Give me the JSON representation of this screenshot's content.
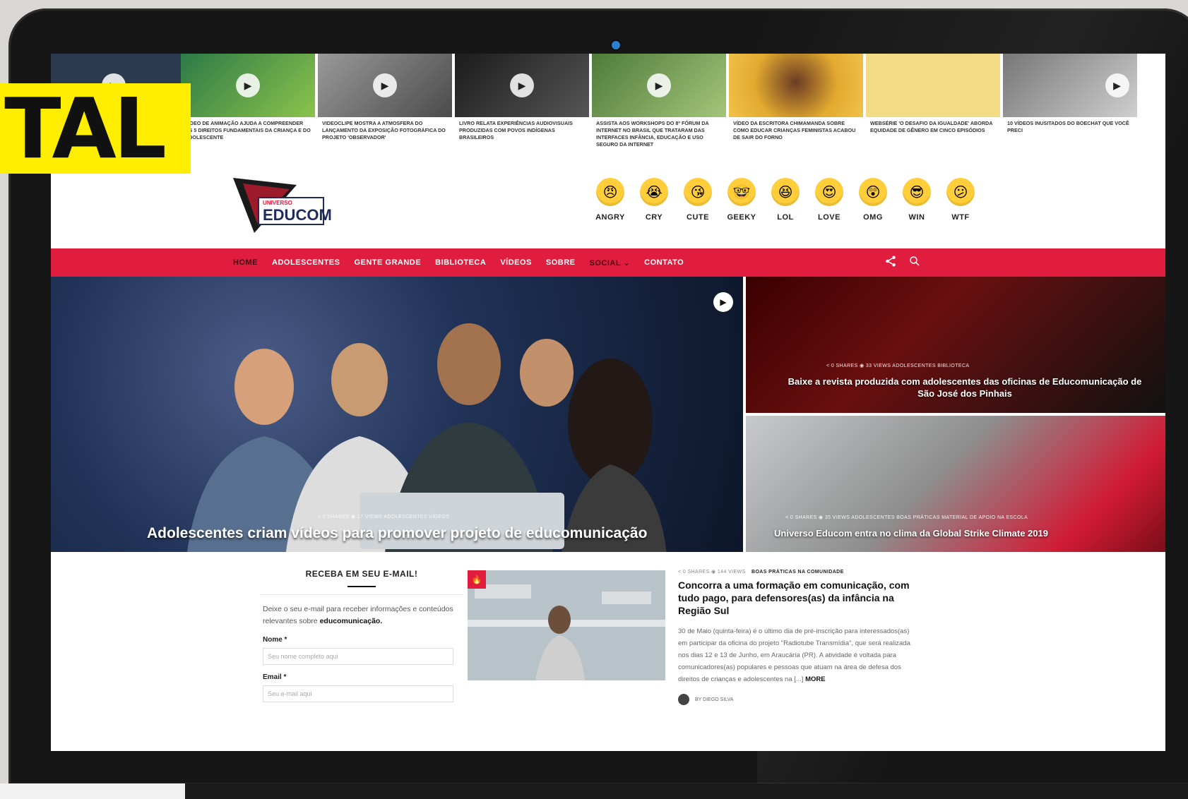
{
  "badge_text": "TAL",
  "video_strip": [
    {
      "title": "VÍDEO DE ANIMAÇÃO AJUDA A COMPREENDER OS 5 DIREITOS FUNDAMENTAIS DA CRIANÇA E DO ADOLESCENTE",
      "color": "#2c7a48"
    },
    {
      "title": "VIDEOCLIPE MOSTRA A ATMOSFERA DO LANÇAMENTO DA EXPOSIÇÃO FOTOGRÁFICA DO PROJETO 'OBSERVADOR'",
      "color": "#7b7b7b"
    },
    {
      "title": "LIVRO RELATA EXPERIÊNCIAS AUDIOVISUAIS PRODUZIDAS COM POVOS INDÍGENAS BRASILEIROS",
      "color": "#2b2b2b"
    },
    {
      "title": "ASSISTA AOS WORKSHOPS DO 8º FÓRUM DA INTERNET NO BRASIL QUE TRATARAM DAS INTERFACES INFÂNCIA, EDUCAÇÃO E USO SEGURO DA INTERNET",
      "color": "#5a7d3a"
    },
    {
      "title": "VÍDEO DA ESCRITORA CHIMAMANDA SOBRE COMO EDUCAR CRIANÇAS FEMINISTAS ACABOU DE SAIR DO FORNO",
      "color": "#e8b53a"
    },
    {
      "title": "WEBSÉRIE 'O DESAFIO DA IGUALDADE' ABORDA EQUIDADE DE GÊNERO EM CINCO EPISÓDIOS",
      "color": "#f1d57a"
    },
    {
      "title": "10 VÍDEOS INUSITADOS DO BOECHAT QUE VOCÊ PRECI",
      "color": "#888888"
    }
  ],
  "logo": {
    "small": "UNIVERSO",
    "main": "EDUCOM"
  },
  "reactions": [
    {
      "label": "ANGRY",
      "emoji": "😠"
    },
    {
      "label": "CRY",
      "emoji": "😭"
    },
    {
      "label": "CUTE",
      "emoji": "😘"
    },
    {
      "label": "GEEKY",
      "emoji": "🤓"
    },
    {
      "label": "LOL",
      "emoji": "😆"
    },
    {
      "label": "LOVE",
      "emoji": "😍"
    },
    {
      "label": "OMG",
      "emoji": "😲"
    },
    {
      "label": "WIN",
      "emoji": "😎"
    },
    {
      "label": "WTF",
      "emoji": "😕"
    }
  ],
  "nav": [
    {
      "label": "HOME",
      "active": true
    },
    {
      "label": "ADOLESCENTES"
    },
    {
      "label": "GENTE GRANDE"
    },
    {
      "label": "BIBLIOTECA"
    },
    {
      "label": "VÍDEOS"
    },
    {
      "label": "SOBRE"
    },
    {
      "label": "SOCIAL ⌄",
      "active": true
    },
    {
      "label": "CONTATO"
    }
  ],
  "nav_icons": {
    "share": "share-icon",
    "search": "search-icon"
  },
  "hero_main": {
    "meta": "< 0 SHARES   ◉ 17 VIEWS    ADOLESCENTES  VÍDEOS",
    "title": "Adolescentes criam vídeos para promover projeto de educomunicação"
  },
  "hero_side": [
    {
      "meta": "< 0 SHARES   ◉ 33 VIEWS    ADOLESCENTES  BIBLIOTECA",
      "title": "Baixe a revista produzida com adolescentes das oficinas de Educomunicação de São José dos Pinhais"
    },
    {
      "meta": "< 0 SHARES   ◉ 35 VIEWS    ADOLESCENTES  BOAS PRÁTICAS  MATERIAL DE APOIO  NA ESCOLA",
      "title": "Universo Educom entra no clima da Global Strike Climate 2019"
    }
  ],
  "newsletter": {
    "title": "RECEBA EM SEU E-MAIL!",
    "desc": "Deixe o seu e-mail para receber informações e conteúdos relevantes sobre",
    "desc_bold": "educomunicação.",
    "name_label": "Nome *",
    "name_placeholder": "Seu nome completo aqui",
    "email_label": "Email *",
    "email_placeholder": "Seu e-mail aqui"
  },
  "article": {
    "meta": "< 0 SHARES   ◉ 144 VIEWS",
    "categories": "BOAS PRÁTICAS  NA COMUNIDADE",
    "title": "Concorra a uma formação em comunicação, com tudo pago, para defensores(as) da infância na Região Sul",
    "body": "30 de Maio (quinta-feira) é o último dia de pré-inscrição para interessados(as) em participar da oficina do projeto \"Radiotube Transmídia\", que será realizada nos dias 12 e 13 de Junho, em Araucária (PR). A atividade é voltada para comunicadores(as) populares e pessoas que atuam na área de defesa dos direitos de crianças e adolescentes na [...]",
    "more": "MORE",
    "author": "BY DIEGO SILVA"
  }
}
